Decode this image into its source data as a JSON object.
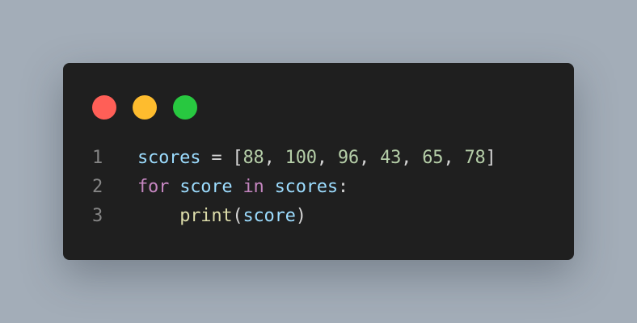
{
  "window": {
    "controls": {
      "close_color": "#ff5f57",
      "minimize_color": "#febc2e",
      "maximize_color": "#28c840"
    }
  },
  "code": {
    "lines": [
      {
        "number": "1",
        "tokens": {
          "var": "scores",
          "eq": " = ",
          "open": "[",
          "n1": "88",
          "c1": ", ",
          "n2": "100",
          "c2": ", ",
          "n3": "96",
          "c3": ", ",
          "n4": "43",
          "c4": ", ",
          "n5": "65",
          "c5": ", ",
          "n6": "78",
          "close": "]"
        }
      },
      {
        "number": "2",
        "tokens": {
          "kw_for": "for",
          "sp1": " ",
          "var_score": "score",
          "sp2": " ",
          "kw_in": "in",
          "sp3": " ",
          "var_scores": "scores",
          "colon": ":"
        }
      },
      {
        "number": "3",
        "tokens": {
          "indent": "    ",
          "fn": "print",
          "open": "(",
          "arg": "score",
          "close": ")"
        }
      }
    ]
  }
}
